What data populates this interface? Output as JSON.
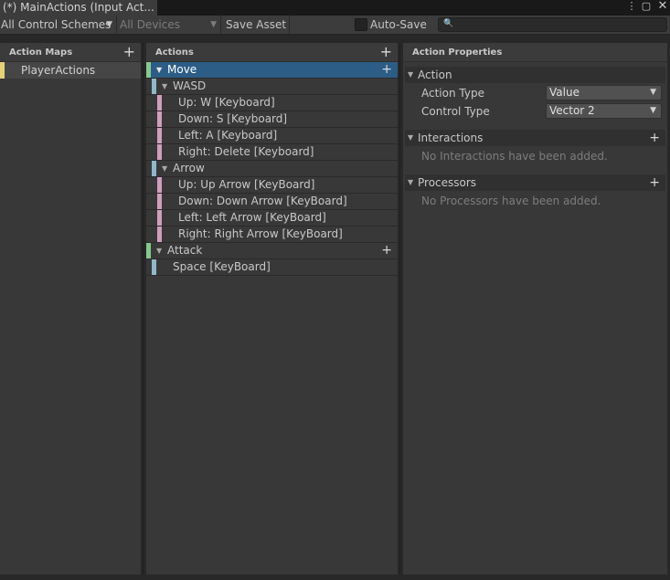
{
  "window": {
    "tab_title": "(*) MainActions (Input Act...",
    "kebab_glyph": "⋮",
    "maximize_glyph": "▢",
    "close_glyph": "✕"
  },
  "toolbar": {
    "control_schemes": "All Control Schemes",
    "devices": "All Devices",
    "save_asset": "Save Asset",
    "auto_save": "Auto-Save",
    "auto_save_checked": false,
    "search_placeholder": "",
    "search_icon": "search-icon"
  },
  "action_maps": {
    "header": "Action Maps",
    "items": [
      {
        "label": "PlayerActions",
        "marker_color": "#e8d07a"
      }
    ]
  },
  "actions": {
    "header": "Actions",
    "rows": [
      {
        "label": "Move",
        "level": 0,
        "kind": "action",
        "expandable": true,
        "selected": true,
        "has_plus": true
      },
      {
        "label": "WASD",
        "level": 1,
        "kind": "composite",
        "expandable": true
      },
      {
        "label": "Up: W [Keyboard]",
        "level": 2,
        "kind": "part"
      },
      {
        "label": "Down: S [Keyboard]",
        "level": 2,
        "kind": "part"
      },
      {
        "label": "Left: A [Keyboard]",
        "level": 2,
        "kind": "part"
      },
      {
        "label": "Right: Delete [Keyboard]",
        "level": 2,
        "kind": "part"
      },
      {
        "label": "Arrow",
        "level": 1,
        "kind": "composite",
        "expandable": true
      },
      {
        "label": "Up: Up Arrow [KeyBoard]",
        "level": 2,
        "kind": "part"
      },
      {
        "label": "Down: Down Arrow [KeyBoard]",
        "level": 2,
        "kind": "part"
      },
      {
        "label": "Left: Left Arrow [KeyBoard]",
        "level": 2,
        "kind": "part"
      },
      {
        "label": "Right: Right Arrow [KeyBoard]",
        "level": 2,
        "kind": "part"
      },
      {
        "label": "Attack",
        "level": 0,
        "kind": "action",
        "expandable": true,
        "has_plus": true
      },
      {
        "label": "Space [KeyBoard]",
        "level": 1,
        "kind": "binding"
      }
    ],
    "colors": {
      "action": "#86c98e",
      "composite": "#8fb8c8",
      "binding": "#8fb8c8",
      "part": "#cf9fbd"
    }
  },
  "properties": {
    "header": "Action Properties",
    "action_section": "Action",
    "action_type_label": "Action Type",
    "action_type_value": "Value",
    "control_type_label": "Control Type",
    "control_type_value": "Vector 2",
    "interactions_section": "Interactions",
    "interactions_empty": "No Interactions have been added.",
    "processors_section": "Processors",
    "processors_empty": "No Processors have been added."
  },
  "colors": {
    "selected_row": "#2c5d87",
    "panel_bg": "#383838"
  }
}
